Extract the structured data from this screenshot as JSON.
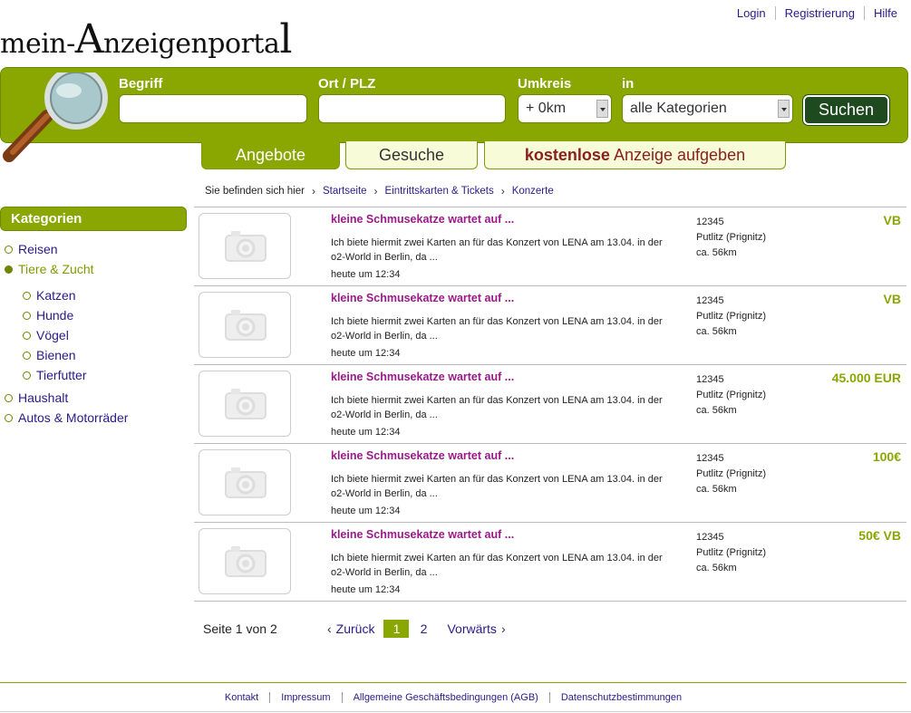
{
  "top_links": [
    "Login",
    "Registrierung",
    "Hilfe"
  ],
  "logo": {
    "part1": "mein-",
    "big": "A",
    "part2": "nzeigenporta",
    "big2": "l"
  },
  "search": {
    "begriff_label": "Begriff",
    "ort_label": "Ort / PLZ",
    "umkreis_label": "Umkreis",
    "umkreis_value": "+ 0km",
    "in_label": "in",
    "kategorie_value": "alle Kategorien",
    "button": "Suchen"
  },
  "tabs": {
    "angebote": "Angebote",
    "gesuche": "Gesuche",
    "free_bold": "kostenlose",
    "free_rest": " Anzeige aufgeben"
  },
  "breadcrumb": {
    "lead": "Sie befinden sich hier",
    "items": [
      "Startseite",
      "Eintrittskarten & Tickets",
      "Konzerte"
    ]
  },
  "sidebar": {
    "title": "Kategorien",
    "items": [
      {
        "label": "Reisen"
      },
      {
        "label": "Tiere & Zucht"
      },
      {
        "label": "Katzen"
      },
      {
        "label": "Hunde"
      },
      {
        "label": "Vögel"
      },
      {
        "label": "Bienen"
      },
      {
        "label": "Tierfutter"
      },
      {
        "label": "Haushalt"
      },
      {
        "label": "Autos & Motorräder"
      }
    ]
  },
  "listings": [
    {
      "title": "kleine Schmusekatze wartet auf ...",
      "desc": "Ich biete hiermit zwei Karten an für das Konzert von LENA am 13.04. in der o2-World in Berlin, da ...",
      "time": "heute um 12:34",
      "zip": "12345",
      "city": "Putlitz (Prignitz)",
      "distance": "ca. 56km",
      "price": "VB"
    },
    {
      "title": "kleine Schmusekatze wartet auf ...",
      "desc": "Ich biete hiermit zwei Karten an für das Konzert von LENA am 13.04. in der o2-World in Berlin, da ...",
      "time": "heute um 12:34",
      "zip": "12345",
      "city": "Putlitz (Prignitz)",
      "distance": "ca. 56km",
      "price": "VB"
    },
    {
      "title": "kleine Schmusekatze wartet auf ...",
      "desc": "Ich biete hiermit zwei Karten an für das Konzert von LENA am 13.04. in der o2-World in Berlin, da ...",
      "time": "heute um 12:34",
      "zip": "12345",
      "city": "Putlitz (Prignitz)",
      "distance": "ca. 56km",
      "price": "45.000 EUR"
    },
    {
      "title": "kleine Schmusekatze wartet auf ...",
      "desc": "Ich biete hiermit zwei Karten an für das Konzert von LENA am 13.04. in der o2-World in Berlin, da ...",
      "time": "heute um 12:34",
      "zip": "12345",
      "city": "Putlitz (Prignitz)",
      "distance": "ca. 56km",
      "price": "100€"
    },
    {
      "title": "kleine Schmusekatze wartet auf ...",
      "desc": "Ich biete hiermit zwei Karten an für das Konzert von LENA am 13.04. in der o2-World in Berlin, da ...",
      "time": "heute um 12:34",
      "zip": "12345",
      "city": "Putlitz (Prignitz)",
      "distance": "ca. 56km",
      "price": "50€ VB"
    }
  ],
  "pager": {
    "info": "Seite 1 von 2",
    "prev": "Zurück",
    "pages": [
      "1",
      "2"
    ],
    "next": "Vorwärts"
  },
  "footer": [
    "Kontakt",
    "Impressum",
    "Allgemeine Geschäftsbedingungen (AGB)",
    "Datenschutzbestimmungen"
  ],
  "colors": {
    "brand_green": "#8aa600",
    "link": "#2a1a8a",
    "title_purple": "#9a1a8a",
    "button_dark": "#1f4a1f"
  }
}
